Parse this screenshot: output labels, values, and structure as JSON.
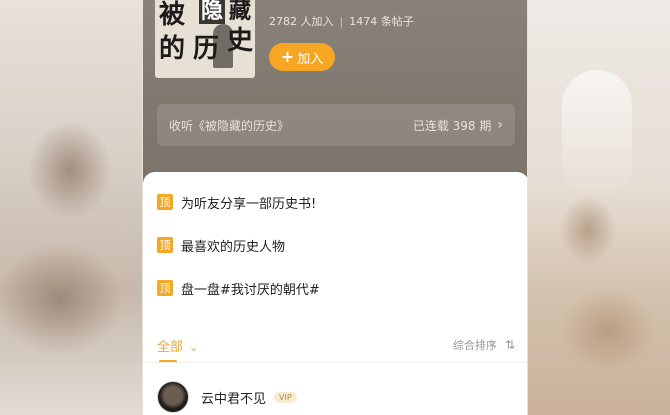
{
  "group": {
    "cover_chars": [
      "被",
      "隐",
      "藏",
      "的",
      "历",
      "史"
    ],
    "members": "2782 人加入",
    "posts": "1474 条帖子",
    "stats_separator": "|",
    "join_icon": "+",
    "join_label": "加入"
  },
  "listen": {
    "label": "收听《被隐藏的历史》",
    "status": "已连载 398 期",
    "chevron": "›"
  },
  "pinned": [
    {
      "badge": "顶",
      "text": "为听友分享一部历史书!"
    },
    {
      "badge": "顶",
      "text": "最喜欢的历史人物"
    },
    {
      "badge": "顶",
      "text": "盘一盘#我讨厌的朝代#"
    }
  ],
  "filter": {
    "all_label": "全部",
    "all_chevron": "⌄",
    "sort_label": "综合排序",
    "sort_icon": "⇅"
  },
  "post": {
    "username": "云中君不见",
    "badge": "VIP"
  },
  "colors": {
    "accent": "#f5a623",
    "header_bg": "#7f786f"
  }
}
